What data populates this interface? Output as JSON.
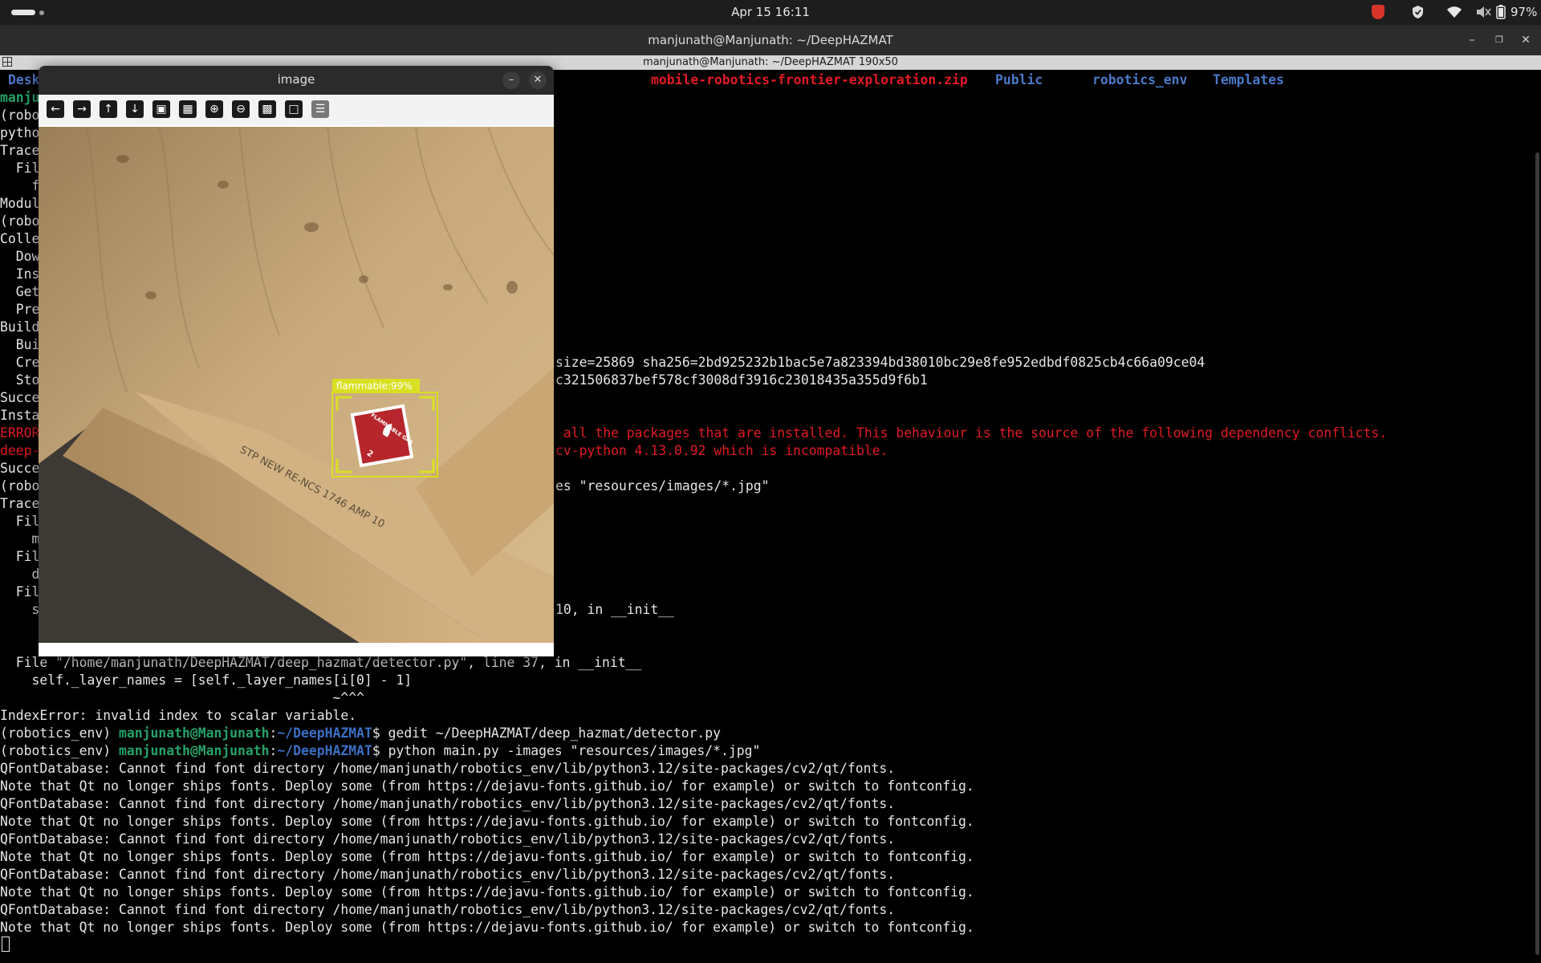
{
  "topbar": {
    "datetime": "Apr 15  16:11",
    "battery": "97%",
    "tray_icons": [
      "brave-icon",
      "shield-icon",
      "wifi-icon",
      "volume-muted-icon",
      "battery-icon"
    ]
  },
  "terminal_window": {
    "title": "manjunath@Manjunath: ~/DeepHAZMAT",
    "size_indicator": "manjunath@Manjunath: ~/DeepHAZMAT 190x50"
  },
  "ls_row": {
    "left": "Desk",
    "zip": "mobile-robotics-frontier-exploration.zip",
    "dirs": [
      "Public",
      "robotics_env",
      "Templates"
    ]
  },
  "left_stubs": [
    "manju",
    "(robo",
    "pytho",
    "Trace",
    "  Fil",
    "    f",
    "Modul",
    "(robo",
    "Colle",
    "  Dow",
    "  Ins",
    "  Get",
    "  Pre",
    "Build",
    "  Bui",
    "  Cre",
    "  Sto",
    "Succe",
    "Insta",
    "ERROR",
    "deep-",
    "Succe",
    "(robo",
    "Trace",
    "  Fil",
    "    m",
    "  Fil",
    "    d",
    "  Fil",
    "    s"
  ],
  "right_fragments": [
    {
      "text": "size=25869 sha256=2bd925232b1bac5e7a823394bd38010bc29e8fe952edbdf0825cb4c66a09ce04",
      "color": "normal"
    },
    {
      "text": "c321506837bef578cf3008df3916c23018435a355d9f6b1",
      "color": "normal"
    },
    {
      "text": " all the packages that are installed. This behaviour is the source of the following dependency conflicts.",
      "color": "red"
    },
    {
      "text": "cv-python 4.13.0.92 which is incompatible.",
      "color": "red"
    },
    {
      "text": "es \"resources/images/*.jpg\"",
      "color": "normal"
    },
    {
      "text": "10, in __init__",
      "color": "normal"
    }
  ],
  "tail_lines": [
    "  File \"/home/manjunath/DeepHAZMAT/deep_hazmat/detector.py\", line 37, in __init__",
    "    self._layer_names = [self._layer_names[i[0] - 1]",
    "                                          ~^^^",
    "IndexError: invalid index to scalar variable."
  ],
  "prompt": {
    "env": "(robotics_env) ",
    "user": "manjunath@Manjunath",
    "path": "~/DeepHAZMAT",
    "symbol": "$ "
  },
  "commands": [
    "gedit ~/DeepHAZMAT/deep_hazmat/detector.py",
    "python main.py -images \"resources/images/*.jpg\""
  ],
  "warnings": [
    "QFontDatabase: Cannot find font directory /home/manjunath/robotics_env/lib/python3.12/site-packages/cv2/qt/fonts.",
    "Note that Qt no longer ships fonts. Deploy some (from https://dejavu-fonts.github.io/ for example) or switch to fontconfig."
  ],
  "image_window": {
    "title": "image",
    "toolbar_icons": [
      "pan-left-icon",
      "pan-right-icon",
      "pan-up-icon",
      "pan-down-icon",
      "zoom-original-icon",
      "zoom-fit-icon",
      "zoom-in-icon",
      "zoom-out-icon",
      "save-icon",
      "copy-icon",
      "properties-icon"
    ],
    "detection": {
      "label": "flammable:99%",
      "placard_text": "FLAMMABLE GAS",
      "placard_class": "2"
    },
    "crate_stencil": "STP NEW RE-NCS 1746 AMP 10",
    "colors": {
      "box": "#d9e021",
      "placard": "#b6262c"
    }
  }
}
